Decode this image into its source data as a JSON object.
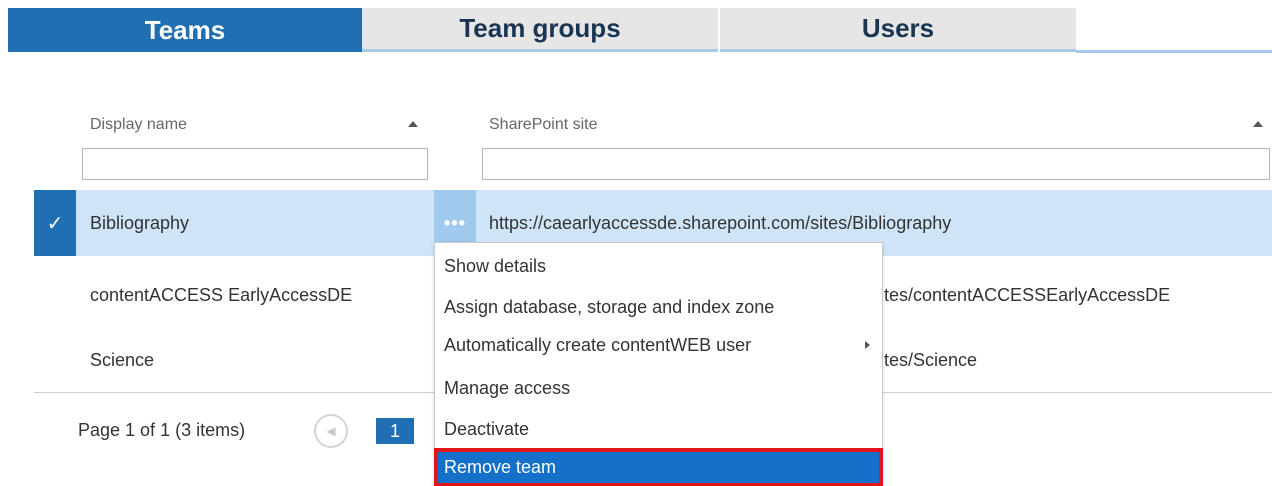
{
  "tabs": [
    {
      "label": "Teams",
      "active": true
    },
    {
      "label": "Team groups",
      "active": false
    },
    {
      "label": "Users",
      "active": false
    }
  ],
  "grid": {
    "columns": [
      {
        "header": "Display name",
        "filter_value": ""
      },
      {
        "header": "SharePoint site",
        "filter_value": ""
      }
    ],
    "rows": [
      {
        "display_name": "Bibliography",
        "site": "https://caearlyaccessde.sharepoint.com/sites/Bibliography",
        "selected": true
      },
      {
        "display_name": "contentACCESS EarlyAccessDE",
        "site_visible": "tes/contentACCESSEarlyAccessDE",
        "selected": false
      },
      {
        "display_name": "Science",
        "site_visible": "tes/Science",
        "selected": false
      }
    ],
    "row_menu_glyph": "•••",
    "check_glyph": "✓"
  },
  "pager": {
    "summary": "Page 1 of 1 (3 items)",
    "current_page": "1",
    "prev_glyph": "◀"
  },
  "context_menu": {
    "items": [
      {
        "label": "Show details"
      },
      {
        "label": "Assign database, storage and index zone"
      },
      {
        "label": "Automatically create contentWEB user",
        "has_submenu": true
      },
      {
        "label": "Manage access"
      },
      {
        "label": "Deactivate"
      },
      {
        "label": "Remove team",
        "highlighted": true
      }
    ]
  },
  "colors": {
    "accent": "#1f6fb2",
    "selected_row": "#cfe5f7",
    "highlight_border": "#e3141b",
    "menu_highlight": "#1570c9"
  }
}
